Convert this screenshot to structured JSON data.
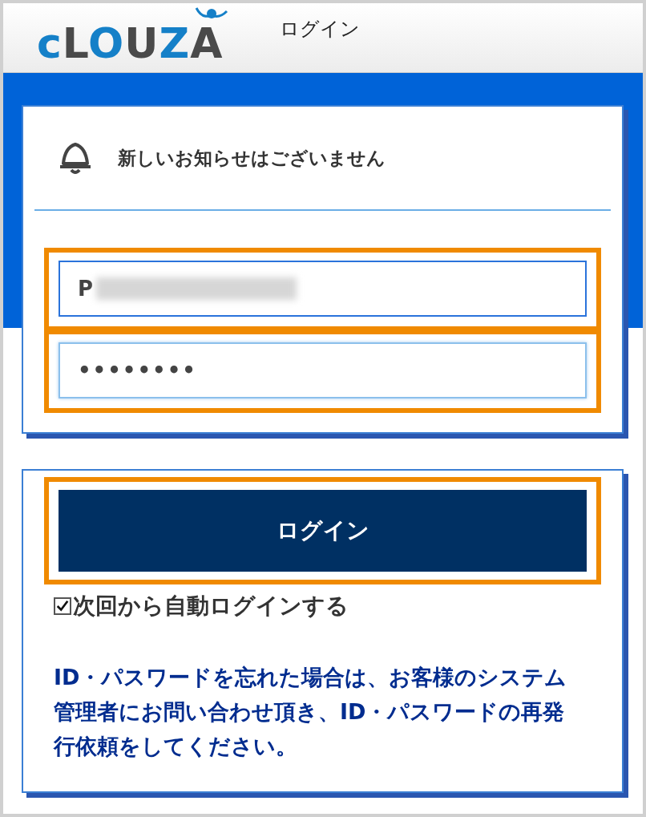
{
  "header": {
    "logo": "cLOUZA",
    "title": "ログイン"
  },
  "notice": {
    "text": "新しいお知らせはございません"
  },
  "login_id": {
    "value": "P",
    "redacted": true
  },
  "password": {
    "value": "••••••••"
  },
  "login_button": {
    "label": "ログイン"
  },
  "auto_login": {
    "label": "次回から自動ログインする",
    "checked": true
  },
  "help_text": "ID・パスワードを忘れた場合は、お客様のシステム管理者にお問い合わせ頂き、ID・パスワードの再発行依頼をしてください。"
}
